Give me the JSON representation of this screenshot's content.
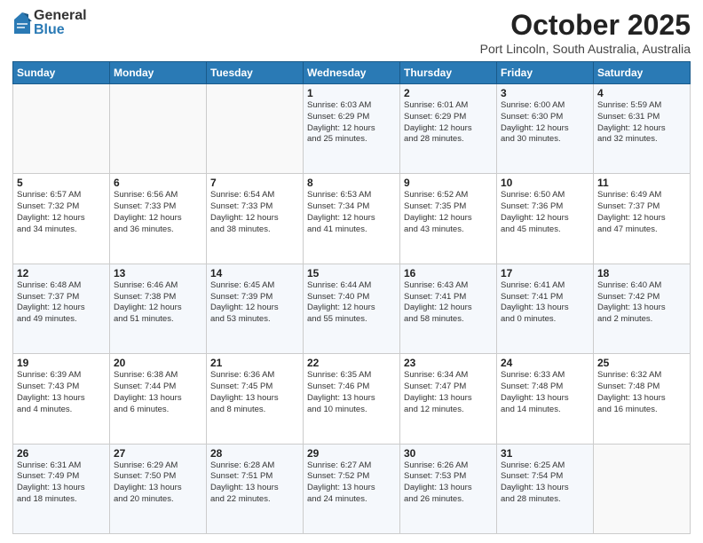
{
  "logo": {
    "general": "General",
    "blue": "Blue"
  },
  "header": {
    "month": "October 2025",
    "location": "Port Lincoln, South Australia, Australia"
  },
  "days_of_week": [
    "Sunday",
    "Monday",
    "Tuesday",
    "Wednesday",
    "Thursday",
    "Friday",
    "Saturday"
  ],
  "weeks": [
    [
      {
        "day": "",
        "info": ""
      },
      {
        "day": "",
        "info": ""
      },
      {
        "day": "",
        "info": ""
      },
      {
        "day": "1",
        "info": "Sunrise: 6:03 AM\nSunset: 6:29 PM\nDaylight: 12 hours\nand 25 minutes."
      },
      {
        "day": "2",
        "info": "Sunrise: 6:01 AM\nSunset: 6:29 PM\nDaylight: 12 hours\nand 28 minutes."
      },
      {
        "day": "3",
        "info": "Sunrise: 6:00 AM\nSunset: 6:30 PM\nDaylight: 12 hours\nand 30 minutes."
      },
      {
        "day": "4",
        "info": "Sunrise: 5:59 AM\nSunset: 6:31 PM\nDaylight: 12 hours\nand 32 minutes."
      }
    ],
    [
      {
        "day": "5",
        "info": "Sunrise: 6:57 AM\nSunset: 7:32 PM\nDaylight: 12 hours\nand 34 minutes."
      },
      {
        "day": "6",
        "info": "Sunrise: 6:56 AM\nSunset: 7:33 PM\nDaylight: 12 hours\nand 36 minutes."
      },
      {
        "day": "7",
        "info": "Sunrise: 6:54 AM\nSunset: 7:33 PM\nDaylight: 12 hours\nand 38 minutes."
      },
      {
        "day": "8",
        "info": "Sunrise: 6:53 AM\nSunset: 7:34 PM\nDaylight: 12 hours\nand 41 minutes."
      },
      {
        "day": "9",
        "info": "Sunrise: 6:52 AM\nSunset: 7:35 PM\nDaylight: 12 hours\nand 43 minutes."
      },
      {
        "day": "10",
        "info": "Sunrise: 6:50 AM\nSunset: 7:36 PM\nDaylight: 12 hours\nand 45 minutes."
      },
      {
        "day": "11",
        "info": "Sunrise: 6:49 AM\nSunset: 7:37 PM\nDaylight: 12 hours\nand 47 minutes."
      }
    ],
    [
      {
        "day": "12",
        "info": "Sunrise: 6:48 AM\nSunset: 7:37 PM\nDaylight: 12 hours\nand 49 minutes."
      },
      {
        "day": "13",
        "info": "Sunrise: 6:46 AM\nSunset: 7:38 PM\nDaylight: 12 hours\nand 51 minutes."
      },
      {
        "day": "14",
        "info": "Sunrise: 6:45 AM\nSunset: 7:39 PM\nDaylight: 12 hours\nand 53 minutes."
      },
      {
        "day": "15",
        "info": "Sunrise: 6:44 AM\nSunset: 7:40 PM\nDaylight: 12 hours\nand 55 minutes."
      },
      {
        "day": "16",
        "info": "Sunrise: 6:43 AM\nSunset: 7:41 PM\nDaylight: 12 hours\nand 58 minutes."
      },
      {
        "day": "17",
        "info": "Sunrise: 6:41 AM\nSunset: 7:41 PM\nDaylight: 13 hours\nand 0 minutes."
      },
      {
        "day": "18",
        "info": "Sunrise: 6:40 AM\nSunset: 7:42 PM\nDaylight: 13 hours\nand 2 minutes."
      }
    ],
    [
      {
        "day": "19",
        "info": "Sunrise: 6:39 AM\nSunset: 7:43 PM\nDaylight: 13 hours\nand 4 minutes."
      },
      {
        "day": "20",
        "info": "Sunrise: 6:38 AM\nSunset: 7:44 PM\nDaylight: 13 hours\nand 6 minutes."
      },
      {
        "day": "21",
        "info": "Sunrise: 6:36 AM\nSunset: 7:45 PM\nDaylight: 13 hours\nand 8 minutes."
      },
      {
        "day": "22",
        "info": "Sunrise: 6:35 AM\nSunset: 7:46 PM\nDaylight: 13 hours\nand 10 minutes."
      },
      {
        "day": "23",
        "info": "Sunrise: 6:34 AM\nSunset: 7:47 PM\nDaylight: 13 hours\nand 12 minutes."
      },
      {
        "day": "24",
        "info": "Sunrise: 6:33 AM\nSunset: 7:48 PM\nDaylight: 13 hours\nand 14 minutes."
      },
      {
        "day": "25",
        "info": "Sunrise: 6:32 AM\nSunset: 7:48 PM\nDaylight: 13 hours\nand 16 minutes."
      }
    ],
    [
      {
        "day": "26",
        "info": "Sunrise: 6:31 AM\nSunset: 7:49 PM\nDaylight: 13 hours\nand 18 minutes."
      },
      {
        "day": "27",
        "info": "Sunrise: 6:29 AM\nSunset: 7:50 PM\nDaylight: 13 hours\nand 20 minutes."
      },
      {
        "day": "28",
        "info": "Sunrise: 6:28 AM\nSunset: 7:51 PM\nDaylight: 13 hours\nand 22 minutes."
      },
      {
        "day": "29",
        "info": "Sunrise: 6:27 AM\nSunset: 7:52 PM\nDaylight: 13 hours\nand 24 minutes."
      },
      {
        "day": "30",
        "info": "Sunrise: 6:26 AM\nSunset: 7:53 PM\nDaylight: 13 hours\nand 26 minutes."
      },
      {
        "day": "31",
        "info": "Sunrise: 6:25 AM\nSunset: 7:54 PM\nDaylight: 13 hours\nand 28 minutes."
      },
      {
        "day": "",
        "info": ""
      }
    ]
  ]
}
